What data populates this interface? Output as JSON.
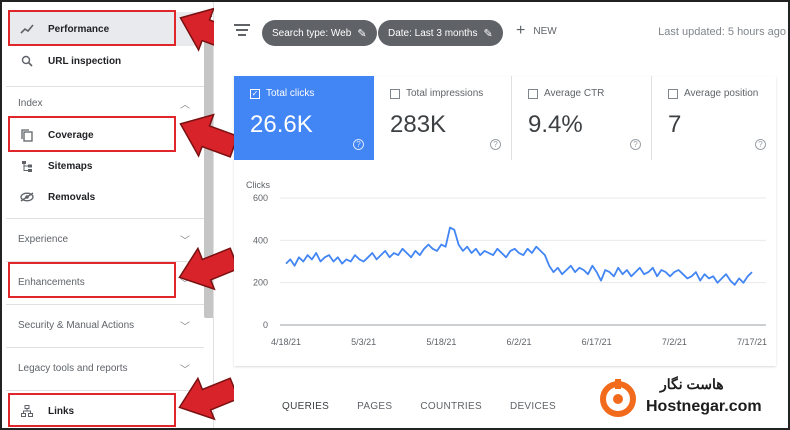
{
  "sidebar": {
    "performance": "Performance",
    "url_inspection": "URL inspection",
    "index_section": "Index",
    "coverage": "Coverage",
    "sitemaps": "Sitemaps",
    "removals": "Removals",
    "experience": "Experience",
    "enhancements": "Enhancements",
    "security": "Security & Manual Actions",
    "legacy": "Legacy tools and reports",
    "links": "Links"
  },
  "toolbar": {
    "search_type": "Search type: Web",
    "date": "Date: Last 3 months",
    "new": "NEW",
    "last_updated": "Last updated: 5 hours ago"
  },
  "metrics": [
    {
      "label": "Total clicks",
      "value": "26.6K",
      "checked": true
    },
    {
      "label": "Total impressions",
      "value": "283K",
      "checked": false
    },
    {
      "label": "Average CTR",
      "value": "9.4%",
      "checked": false
    },
    {
      "label": "Average position",
      "value": "7",
      "checked": false
    }
  ],
  "tabs": [
    "QUERIES",
    "PAGES",
    "COUNTRIES",
    "DEVICES"
  ],
  "logo": {
    "fa": "هاست نگار",
    "en": "Hostnegar.com"
  },
  "colors": {
    "accent": "#4285f4",
    "highlight": "#e0262b",
    "chip": "#5f6368"
  },
  "chart_data": {
    "type": "line",
    "ylabel": "Clicks",
    "ylim": [
      0,
      600
    ],
    "yticks": [
      0,
      200,
      400,
      600
    ],
    "xticks": [
      "4/18/21",
      "5/3/21",
      "5/18/21",
      "6/2/21",
      "6/17/21",
      "7/2/21",
      "7/17/21"
    ],
    "grid": true,
    "series": [
      {
        "values": [
          290,
          310,
          280,
          320,
          300,
          330,
          310,
          340,
          300,
          320,
          330,
          300,
          320,
          290,
          310,
          300,
          330,
          310,
          300,
          320,
          340,
          310,
          330,
          350,
          320,
          340,
          330,
          360,
          340,
          320,
          350,
          330,
          360,
          380,
          360,
          350,
          380,
          370,
          460,
          450,
          380,
          350,
          370,
          340,
          360,
          330,
          350,
          340,
          330,
          360,
          340,
          320,
          350,
          360,
          340,
          330,
          360,
          340,
          370,
          350,
          330,
          280,
          250,
          270,
          240,
          260,
          280,
          250,
          270,
          260,
          240,
          280,
          250,
          210,
          260,
          250,
          230,
          270,
          240,
          260,
          230,
          250,
          270,
          240,
          250,
          270,
          230,
          260,
          250,
          230,
          250,
          260,
          240,
          220,
          230,
          250,
          210,
          240,
          220,
          230,
          200,
          220,
          240,
          210,
          190,
          220,
          200,
          230,
          250
        ]
      }
    ]
  }
}
